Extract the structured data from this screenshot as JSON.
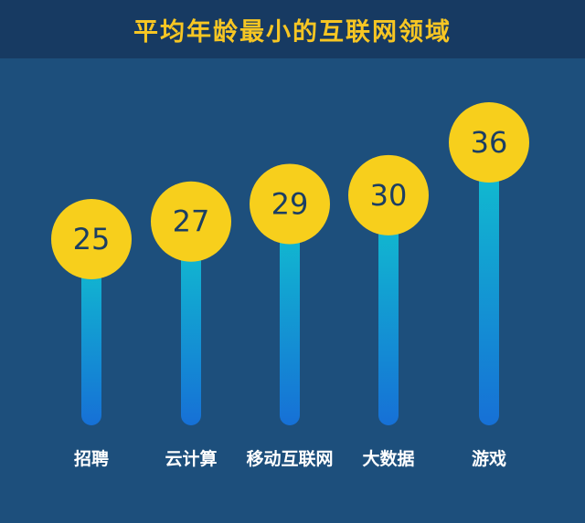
{
  "header": {
    "title": "平均年龄最小的互联网领域"
  },
  "colors": {
    "background": "#1d4f7c",
    "title_bar": "#173a62",
    "title_text": "#f7c623",
    "bubble": "#f7cf1c",
    "bubble_text": "#1b3e63",
    "bar_top": "#10c3cf",
    "bar_bottom": "#1670d6",
    "label_text": "#ffffff"
  },
  "chart_data": {
    "type": "bar",
    "title": "平均年龄最小的互联网领域",
    "categories": [
      "招聘",
      "云计算",
      "移动互联网",
      "大数据",
      "游戏"
    ],
    "values": [
      25,
      27,
      29,
      30,
      36
    ],
    "xlabel": "",
    "ylabel": "",
    "grid": false,
    "legend": "none"
  }
}
